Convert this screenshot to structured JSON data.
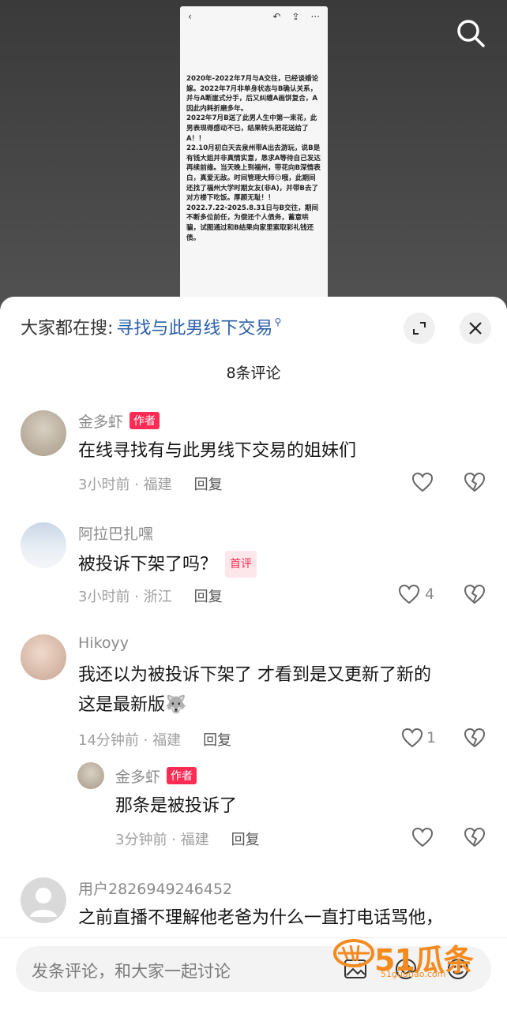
{
  "post_image": {
    "paragraphs": [
      "2020年-2022年7月与A交往，已经谈婚论嫁。2022年7月非单身状态与B确认关系，并与A断崖式分手，后又纠缠A画饼复合，A因此内耗折磨多年。",
      "2022年7月B送了此男人生中第一束花，此男表现得感动不已，结果转头把花送给了A！！",
      "22.10月初白天去泉州带A出去游玩，说B是有钱大姐并非真情实意，恳求A等待自己发达再续前缘。当天晚上到福州，带花向B深情表白，真爱无敌。时间管理大师😊哦，此期间还找了福州大学时期女友(非A)，并带B去了对方楼下吃饭。厚颜无耻！！",
      "2022.7.22-2025.8.31日与B交往，期间不断多位前任，为偿还个人债务，蓄意哄骗，试图通过和B结果向家里索取彩礼钱还债。"
    ]
  },
  "sheet": {
    "hot_prefix": "大家都在搜:",
    "hot_query": "寻找与此男线下交易",
    "comment_count": "8条评论"
  },
  "comments": [
    {
      "user": "金多虾",
      "tag": "作者",
      "text": "在线寻找有与此男线下交易的姐妹们",
      "meta": "3小时前 · 福建",
      "reply": "回复",
      "likes": ""
    },
    {
      "user": "阿拉巴扎嘿",
      "tag": "首评",
      "text": "被投诉下架了吗？",
      "meta": "3小时前 · 浙江",
      "reply": "回复",
      "likes": "4"
    },
    {
      "user": "Hikoyy",
      "text_line1": "我还以为被投诉下架了 才看到是又更新了新的",
      "text_line2": "这是最新版🐺",
      "meta": "14分钟前 · 福建",
      "reply": "回复",
      "likes": "1"
    },
    {
      "user": "金多虾",
      "tag": "作者",
      "text": "那条是被投诉了",
      "meta": "3分钟前 · 福建",
      "reply": "回复",
      "likes": ""
    },
    {
      "user": "用户2826949246452",
      "text": "之前直播不理解他老爸为什么一直打电话骂他，"
    }
  ],
  "input": {
    "placeholder": "发条评论，和大家一起讨论"
  },
  "watermark": {
    "brand": "51瓜条",
    "url": "51guatiao.com"
  }
}
